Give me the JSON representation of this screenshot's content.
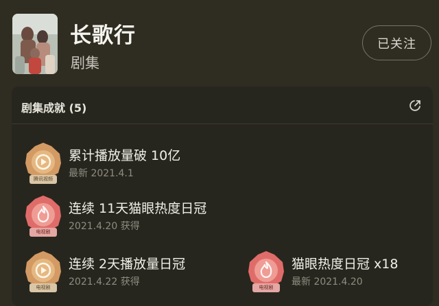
{
  "header": {
    "title": "长歌行",
    "subtitle": "剧集",
    "follow_label": "已关注"
  },
  "panel": {
    "title": "剧集成就 (5)"
  },
  "achievements": [
    {
      "name": "累计播放量破 10亿",
      "date": "最新 2021.4.1",
      "badge_color": "gold",
      "badge_tag": "腾讯视频"
    },
    {
      "name": "连续 11天猫眼热度日冠",
      "date": "2021.4.20 获得",
      "badge_color": "red",
      "badge_tag": "电视剧"
    },
    {
      "name": "连续 2天播放量日冠",
      "date": "2021.4.22 获得",
      "badge_color": "gold",
      "badge_tag": "电视剧"
    },
    {
      "name": "猫眼热度日冠 x18",
      "date": "最新 2021.4.20",
      "badge_color": "red",
      "badge_tag": "电视剧"
    }
  ],
  "colors": {
    "background": "#2f2d22",
    "panel": "#27261e",
    "gold_badge": "#d39a64",
    "red_badge": "#e06c69"
  }
}
